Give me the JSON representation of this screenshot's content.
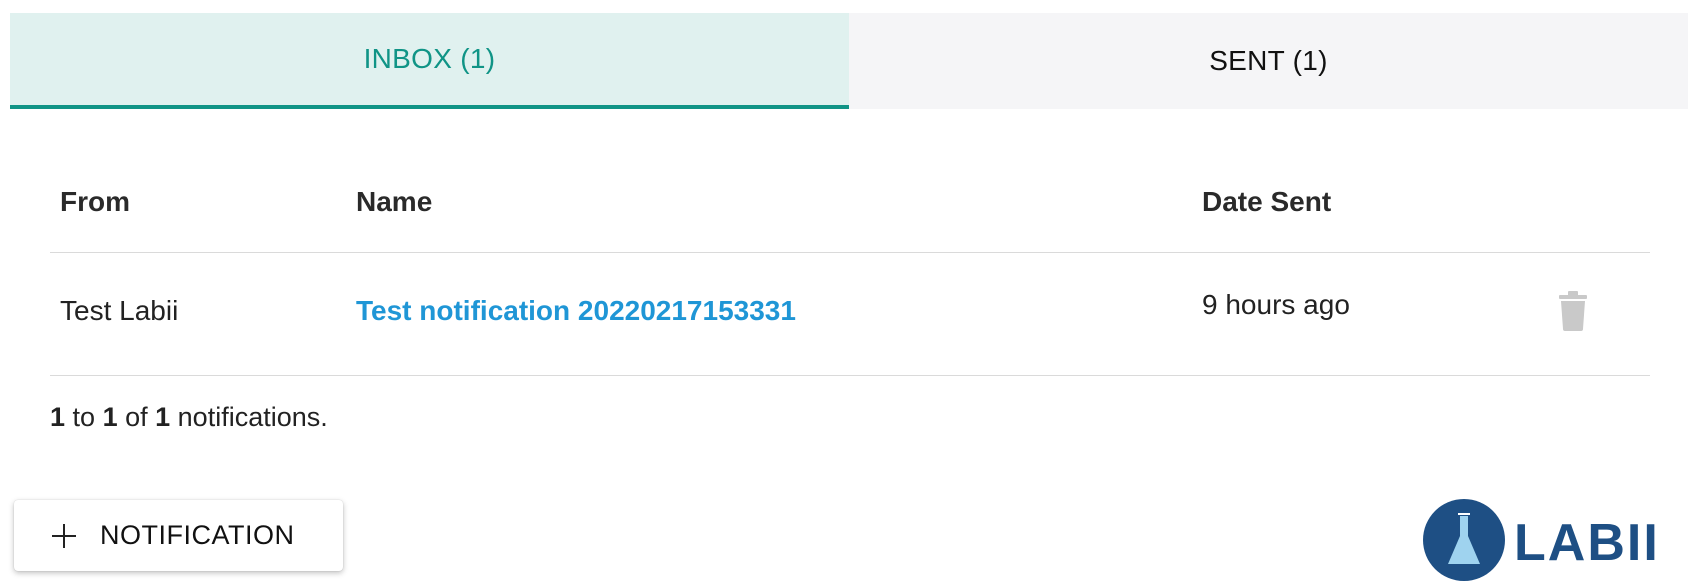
{
  "tabs": [
    {
      "label": "INBOX (1)",
      "active": true
    },
    {
      "label": "SENT (1)",
      "active": false
    }
  ],
  "table": {
    "headers": {
      "from": "From",
      "name": "Name",
      "date_sent": "Date Sent"
    },
    "rows": [
      {
        "from": "Test Labii",
        "name": "Test notification 20220217153331",
        "date_sent": "9 hours ago"
      }
    ]
  },
  "pagination": {
    "start": "1",
    "sep1": " to ",
    "end": "1",
    "sep2": " of ",
    "total": "1",
    "suffix": " notifications."
  },
  "actions": {
    "add_notification_label": "NOTIFICATION"
  },
  "logo": {
    "text": "LABII"
  },
  "colors": {
    "accent": "#109486",
    "active_tab_bg": "#e0f1ef",
    "link": "#1f96d6",
    "logo": "#1e4f84"
  },
  "icons": {
    "trash": "trash-icon",
    "plus": "plus-icon",
    "logo_mark": "flask-icon"
  }
}
